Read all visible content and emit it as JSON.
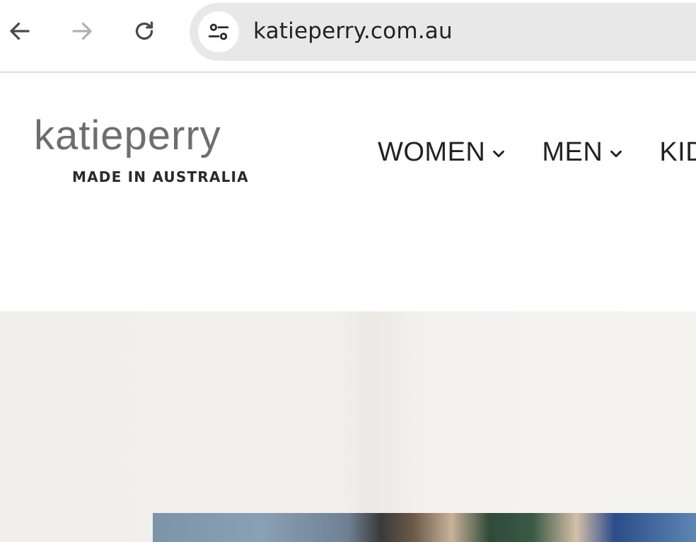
{
  "browser": {
    "url": "katieperry.com.au",
    "icons": {
      "back": "back-arrow-icon",
      "forward": "forward-arrow-icon",
      "reload": "reload-icon",
      "site_info": "site-settings-icon"
    },
    "colors": {
      "address_bar_bg": "#e8e8e8",
      "forward_disabled": "#b0b0b0"
    }
  },
  "header": {
    "logo": {
      "wordmark": "katieperry",
      "tagline": "MADE IN AUSTRALIA"
    },
    "nav": [
      {
        "label": "WOMEN",
        "has_dropdown": true
      },
      {
        "label": "MEN",
        "has_dropdown": true
      },
      {
        "label": "KID",
        "has_dropdown": false
      }
    ]
  }
}
